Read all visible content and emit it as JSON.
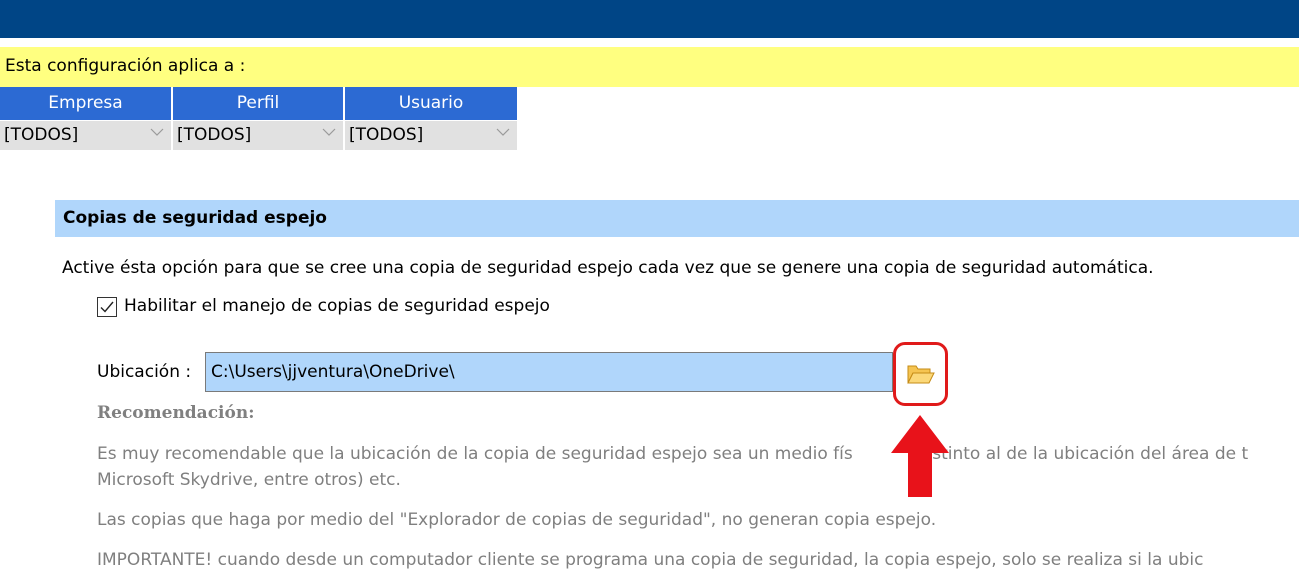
{
  "applies_to": {
    "label": "Esta configuración aplica a :"
  },
  "scope": {
    "columns": [
      {
        "header": "Empresa",
        "selected": "[TODOS]"
      },
      {
        "header": "Perfil",
        "selected": "[TODOS]"
      },
      {
        "header": "Usuario",
        "selected": "[TODOS]"
      }
    ]
  },
  "section": {
    "title": "Copias de seguridad espejo",
    "description": "Active ésta opción para que se cree una copia de seguridad espejo cada vez que se genere una copia de seguridad automática.",
    "enable_checkbox": {
      "label": "Habilitar el manejo de copias de seguridad espejo",
      "checked": true
    },
    "location": {
      "label": "Ubicación :",
      "value": "C:\\Users\\jjventura\\OneDrive\\"
    },
    "recommendation": {
      "title": "Recomendación:",
      "line1": "Es muy recomendable que la ubicación de la copia de seguridad espejo sea un medio fís",
      "line1b": "distinto al de la ubicación del área de t",
      "line2": "Microsoft Skydrive, entre otros) etc.",
      "line3": "Las copias que haga por medio del \"Explorador de copias de seguridad\", no generan copia espejo.",
      "line4": "IMPORTANTE! cuando desde un computador cliente se programa una copia de seguridad, la copia espejo, solo se realiza si la ubic"
    }
  },
  "colors": {
    "title_bar": "#004586",
    "applies_bar": "#ffff80",
    "scope_header": "#2c6ad3",
    "section_bar": "#b0d6fb",
    "highlight": "#e01a1a"
  },
  "icons": {
    "browse": "folder-open-icon",
    "dropdown": "chevron-down-icon",
    "checkbox": "checkmark-icon",
    "pointer": "arrow-up-icon"
  }
}
